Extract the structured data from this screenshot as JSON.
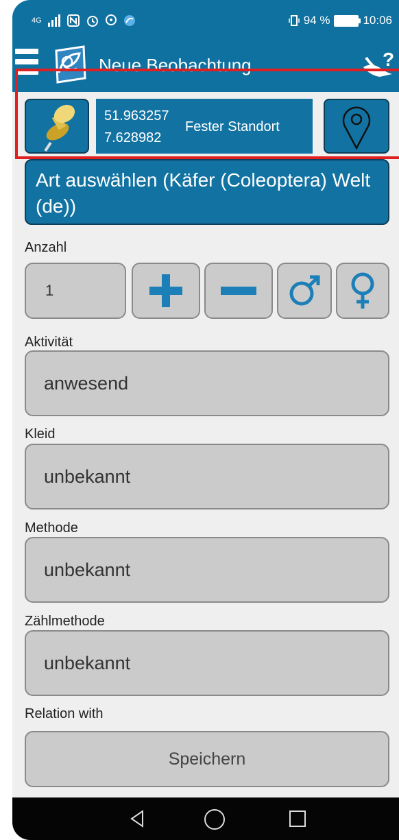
{
  "status_bar": {
    "network": "4G",
    "battery_text": "94 %",
    "time": "10:06"
  },
  "app_bar": {
    "title": "Neue Beobachtung",
    "icons": [
      "menu-icon",
      "app-logo-icon",
      "help-icon"
    ]
  },
  "location": {
    "latitude": "51.963257",
    "longitude": "7.628982",
    "mode_label": "Fester Standort",
    "icons": [
      "pushpin-icon",
      "map-marker-icon"
    ]
  },
  "species": {
    "label": "Art auswählen (Käfer (Coleoptera) Welt (de))"
  },
  "count": {
    "label": "Anzahl",
    "value": "1",
    "icons": [
      "plus-icon",
      "minus-icon",
      "male-icon",
      "female-icon"
    ]
  },
  "activity": {
    "label": "Aktivität",
    "value": "anwesend"
  },
  "plumage": {
    "label": "Kleid",
    "value": "unbekannt"
  },
  "method": {
    "label": "Methode",
    "value": "unbekannt"
  },
  "count_method": {
    "label": "Zählmethode",
    "value": "unbekannt"
  },
  "relation": {
    "label": "Relation with"
  },
  "save": {
    "label": "Speichern"
  },
  "colors": {
    "primary": "#0f71a0",
    "button_blue": "#1273a3",
    "field_gray": "#cbcbcb",
    "highlight_red": "#e02020",
    "background": "#efefef"
  }
}
